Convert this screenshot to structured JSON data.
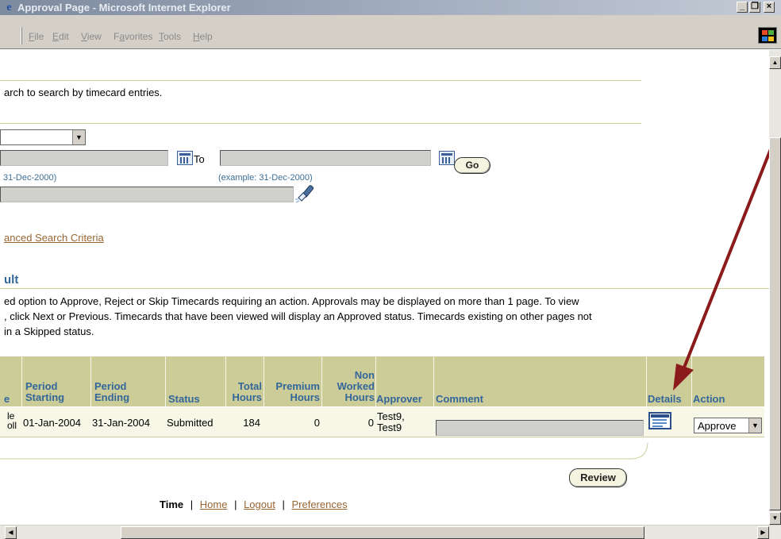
{
  "window": {
    "title": "Approval Page - Microsoft Internet Explorer",
    "controls": {
      "minimize": "_",
      "maximize": "❐",
      "close": "×"
    }
  },
  "menu": {
    "items": [
      {
        "label": "File",
        "accel": "F",
        "rest": "ile"
      },
      {
        "label": "Edit",
        "accel": "E",
        "rest": "dit"
      },
      {
        "label": "View",
        "accel": "V",
        "rest": "iew"
      },
      {
        "label": "Favorites",
        "accel": "a",
        "pre": "F",
        "rest": "vorites"
      },
      {
        "label": "Tools",
        "accel": "T",
        "rest": "ools"
      },
      {
        "label": "Help",
        "accel": "H",
        "rest": "elp"
      }
    ]
  },
  "search": {
    "instructions": "arch to search by timecard entries.",
    "to_label": "To",
    "from_example": "31-Dec-2000)",
    "to_example": "(example: 31-Dec-2000)",
    "go_label": "Go",
    "advanced_link": "anced Search Criteria"
  },
  "results": {
    "heading": "ult",
    "description_lines": [
      "ed option to Approve, Reject or Skip Timecards requiring an action. Approvals may be displayed on more than 1 page. To view",
      ", click Next or Previous. Timecards that have been viewed will display an Approved status. Timecards existing on other pages not",
      " in a Skipped status."
    ],
    "columns": {
      "cut": "e",
      "period_starting": [
        "Period",
        "Starting"
      ],
      "period_ending": [
        "Period",
        "Ending"
      ],
      "status": "Status",
      "total_hours": [
        "Total",
        "Hours"
      ],
      "premium_hours": [
        "Premium",
        "Hours"
      ],
      "non_worked_hours": [
        "Non",
        "Worked",
        "Hours"
      ],
      "approver": "Approver",
      "comment": "Comment",
      "details": "Details",
      "action": "Action"
    },
    "rows": [
      {
        "cut": [
          "le",
          "oll"
        ],
        "period_starting": "01-Jan-2004",
        "period_ending": "31-Jan-2004",
        "status": "Submitted",
        "total_hours": "184",
        "premium_hours": "0",
        "non_worked_hours": "0",
        "approver": [
          "Test9,",
          "Test9"
        ],
        "comment": "",
        "action": "Approve"
      }
    ],
    "review_label": "Review"
  },
  "footer": {
    "current": "Time",
    "separator": "|",
    "links": [
      "Home",
      "Logout",
      "Preferences"
    ]
  },
  "colors": {
    "header_bg": "#cccc99",
    "header_text": "#336699",
    "row_bg": "#f7f7e7",
    "link": "#996633",
    "annotation_arrow": "#8b1a1a"
  }
}
